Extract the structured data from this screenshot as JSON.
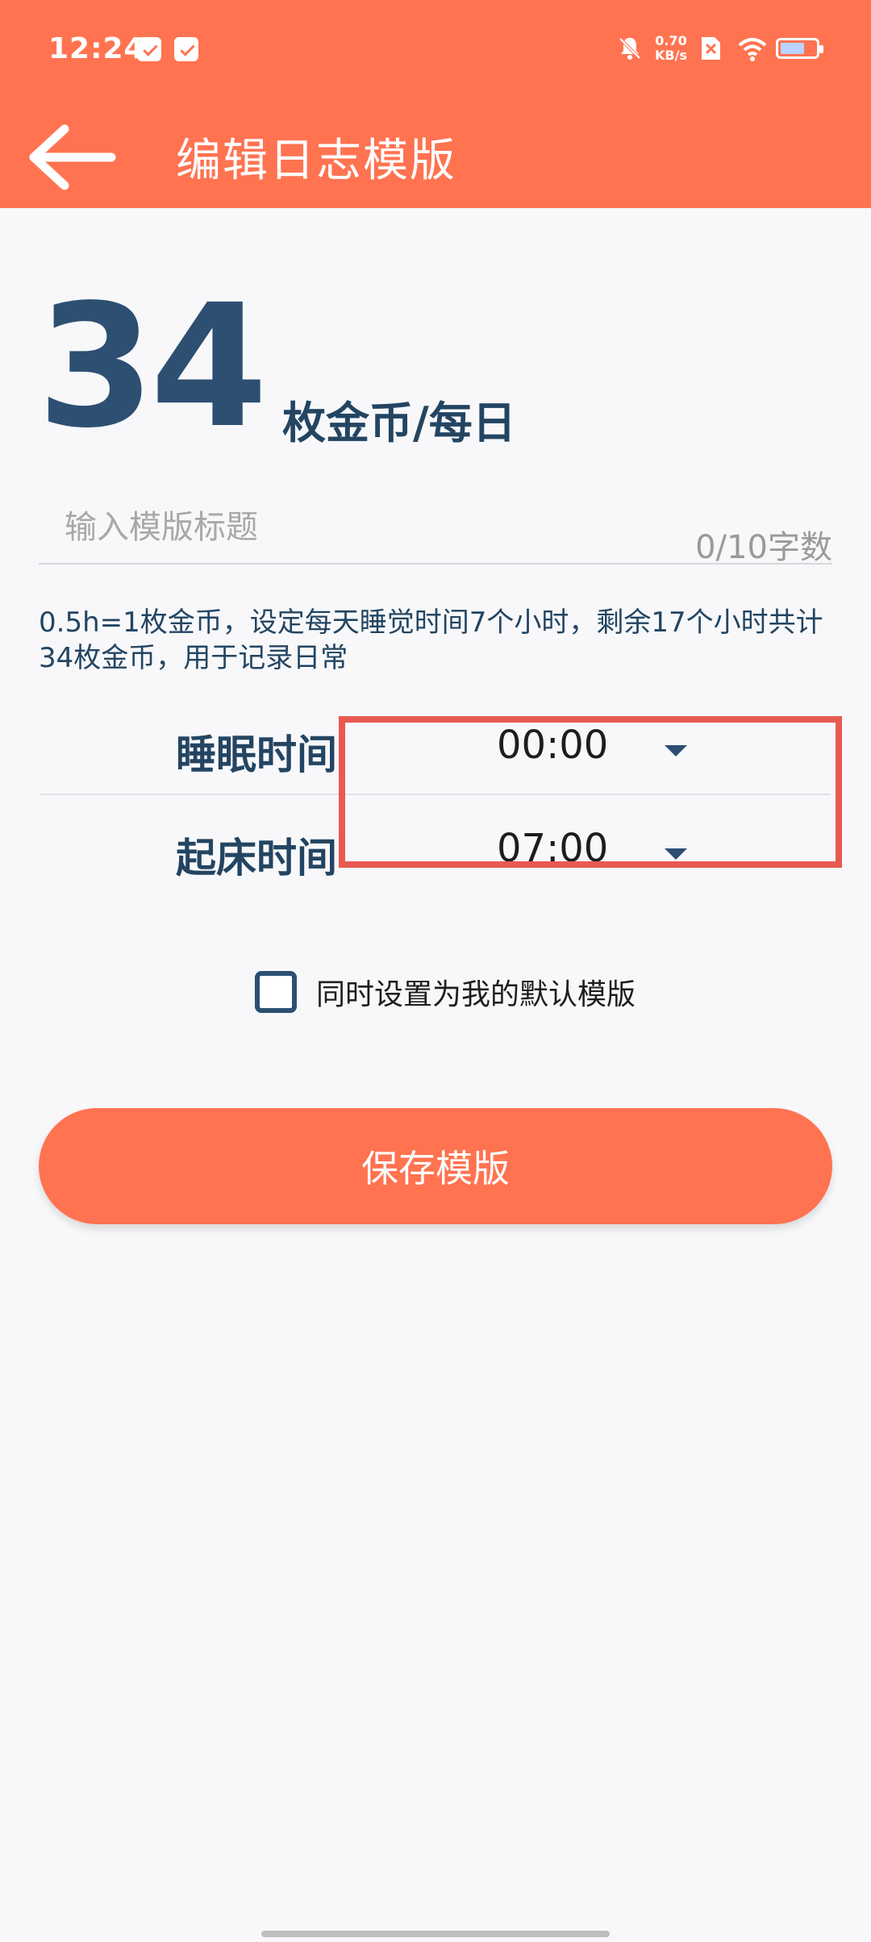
{
  "status_bar": {
    "time": "12:24",
    "speed_value": "0.70",
    "speed_unit": "KB/s"
  },
  "app_bar": {
    "title": "编辑日志模版"
  },
  "coins": {
    "number": "34",
    "unit": "枚金币/每日"
  },
  "title_input": {
    "placeholder": "输入模版标题",
    "value": "",
    "count": "0/10字数"
  },
  "description": "0.5h=1枚金币，设定每天睡觉时间7个小时，剩余17个小时共计34枚金币，用于记录日常",
  "sleep": {
    "label": "睡眠时间",
    "value": "00:00"
  },
  "wake": {
    "label": "起床时间",
    "value": "07:00"
  },
  "default_option": {
    "label": "同时设置为我的默认模版",
    "checked": false
  },
  "save_button": {
    "label": "保存模版"
  },
  "colors": {
    "accent": "#ff7351",
    "primary_text": "#234562",
    "highlight": "#e85a50"
  },
  "icons": {
    "back": "arrow-left-icon",
    "notifications": [
      "calendar-icon",
      "message-icon"
    ],
    "mute": "bell-off-icon",
    "sim": "no-sim-icon",
    "wifi": "wifi-icon",
    "battery": "battery-icon",
    "dropdown": "caret-down-icon"
  }
}
